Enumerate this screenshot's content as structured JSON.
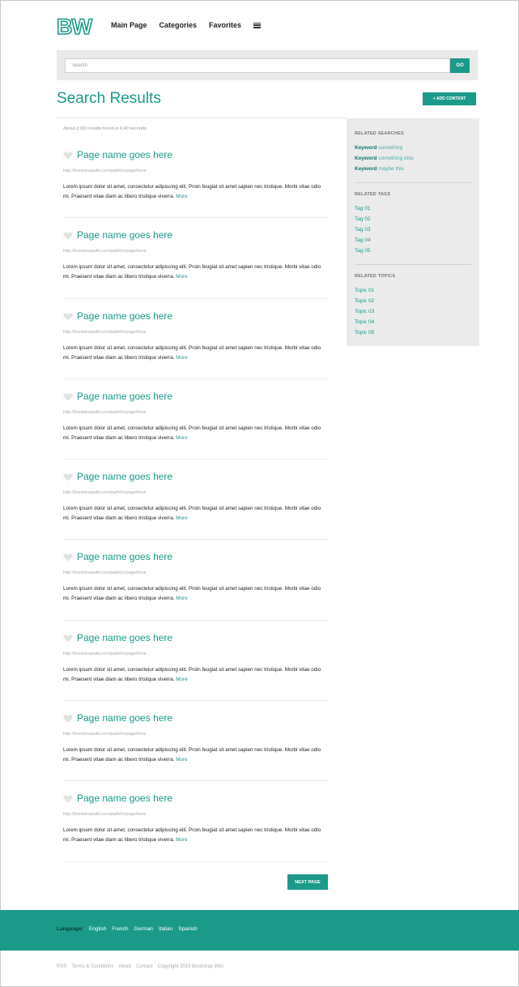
{
  "header": {
    "logo": "BW",
    "nav": [
      "Main Page",
      "Categories",
      "Favorites"
    ]
  },
  "search": {
    "placeholder": "Search",
    "go_label": "GO"
  },
  "main": {
    "title": "Search Results",
    "add_content_label": "+ ADD CONTENT",
    "results_count": "About 2,000 results found in 0.40 seconds",
    "results": [
      {
        "title": "Page name goes here",
        "url": "http://bootstrapwiki.com/path/to/page/here",
        "snippet": "Lorem ipsum dolor sit amet, consectetur adipiscing elit. Proin feugiat sit amet sapien nec tristique. Morbi vitae odio mi. Praesent vitae diam ac libero tristique viverra.",
        "more": "More"
      },
      {
        "title": "Page name goes here",
        "url": "http://bootstrapwiki.com/path/to/page/here",
        "snippet": "Lorem ipsum dolor sit amet, consectetur adipiscing elit. Proin feugiat sit amet sapien nec tristique. Morbi vitae odio mi. Praesent vitae diam ac libero tristique viverra.",
        "more": "More"
      },
      {
        "title": "Page name goes here",
        "url": "http://bootstrapwiki.com/path/to/page/here",
        "snippet": "Lorem ipsum dolor sit amet, consectetur adipiscing elit. Proin feugiat sit amet sapien nec tristique. Morbi vitae odio mi. Praesent vitae diam ac libero tristique viverra.",
        "more": "More"
      },
      {
        "title": "Page name goes here",
        "url": "http://bootstrapwiki.com/path/to/page/here",
        "snippet": "Lorem ipsum dolor sit amet, consectetur adipiscing elit. Proin feugiat sit amet sapien nec tristique. Morbi vitae odio mi. Praesent vitae diam ac libero tristique viverra.",
        "more": "More"
      },
      {
        "title": "Page name goes here",
        "url": "http://bootstrapwiki.com/path/to/page/here",
        "snippet": "Lorem ipsum dolor sit amet, consectetur adipiscing elit. Proin feugiat sit amet sapien nec tristique. Morbi vitae odio mi. Praesent vitae diam ac libero tristique viverra.",
        "more": "More"
      },
      {
        "title": "Page name goes here",
        "url": "http://bootstrapwiki.com/path/to/page/here",
        "snippet": "Lorem ipsum dolor sit amet, consectetur adipiscing elit. Proin feugiat sit amet sapien nec tristique. Morbi vitae odio mi. Praesent vitae diam ac libero tristique viverra.",
        "more": "More"
      },
      {
        "title": "Page name goes here",
        "url": "http://bootstrapwiki.com/path/to/page/here",
        "snippet": "Lorem ipsum dolor sit amet, consectetur adipiscing elit. Proin feugiat sit amet sapien nec tristique. Morbi vitae odio mi. Praesent vitae diam ac libero tristique viverra.",
        "more": "More"
      },
      {
        "title": "Page name goes here",
        "url": "http://bootstrapwiki.com/path/to/page/here",
        "snippet": "Lorem ipsum dolor sit amet, consectetur adipiscing elit. Proin feugiat sit amet sapien nec tristique. Morbi vitae odio mi. Praesent vitae diam ac libero tristique viverra.",
        "more": "More"
      },
      {
        "title": "Page name goes here",
        "url": "http://bootstrapwiki.com/path/to/page/here",
        "snippet": "Lorem ipsum dolor sit amet, consectetur adipiscing elit. Proin feugiat sit amet sapien nec tristique. Morbi vitae odio mi. Praesent vitae diam ac libero tristique viverra.",
        "more": "More"
      }
    ],
    "next_page_label": "NEXT PAGE"
  },
  "sidebar": {
    "related_searches": {
      "heading": "RELATED SEARCHES",
      "items": [
        {
          "keyword": "Keyword",
          "rest": "something"
        },
        {
          "keyword": "Keyword",
          "rest": "something else"
        },
        {
          "keyword": "Keyword",
          "rest": "maybe this"
        }
      ]
    },
    "related_tags": {
      "heading": "RELATED TAGS",
      "items": [
        "Tag 01",
        "Tag 02",
        "Tag 03",
        "Tag 04",
        "Tag 05"
      ]
    },
    "related_topics": {
      "heading": "RELATED TOPICS",
      "items": [
        "Topic 01",
        "Topic 02",
        "Topic 03",
        "Topic 04",
        "Topic 05"
      ]
    }
  },
  "footer": {
    "language_label": "Language:",
    "languages": [
      "English",
      "French",
      "German",
      "Italian",
      "Spanish"
    ],
    "links": [
      "RSS",
      "Terms & Conditions",
      "About",
      "Contact",
      "Copyright 2015 Bootstrap Wiki"
    ]
  },
  "colors": {
    "accent": "#1b9a8a",
    "sidebar_bg": "#ebebeb",
    "search_band_bg": "#e9e9e9"
  },
  "icons": {
    "favorite": "heart-icon",
    "menu": "hamburger-menu-icon"
  }
}
